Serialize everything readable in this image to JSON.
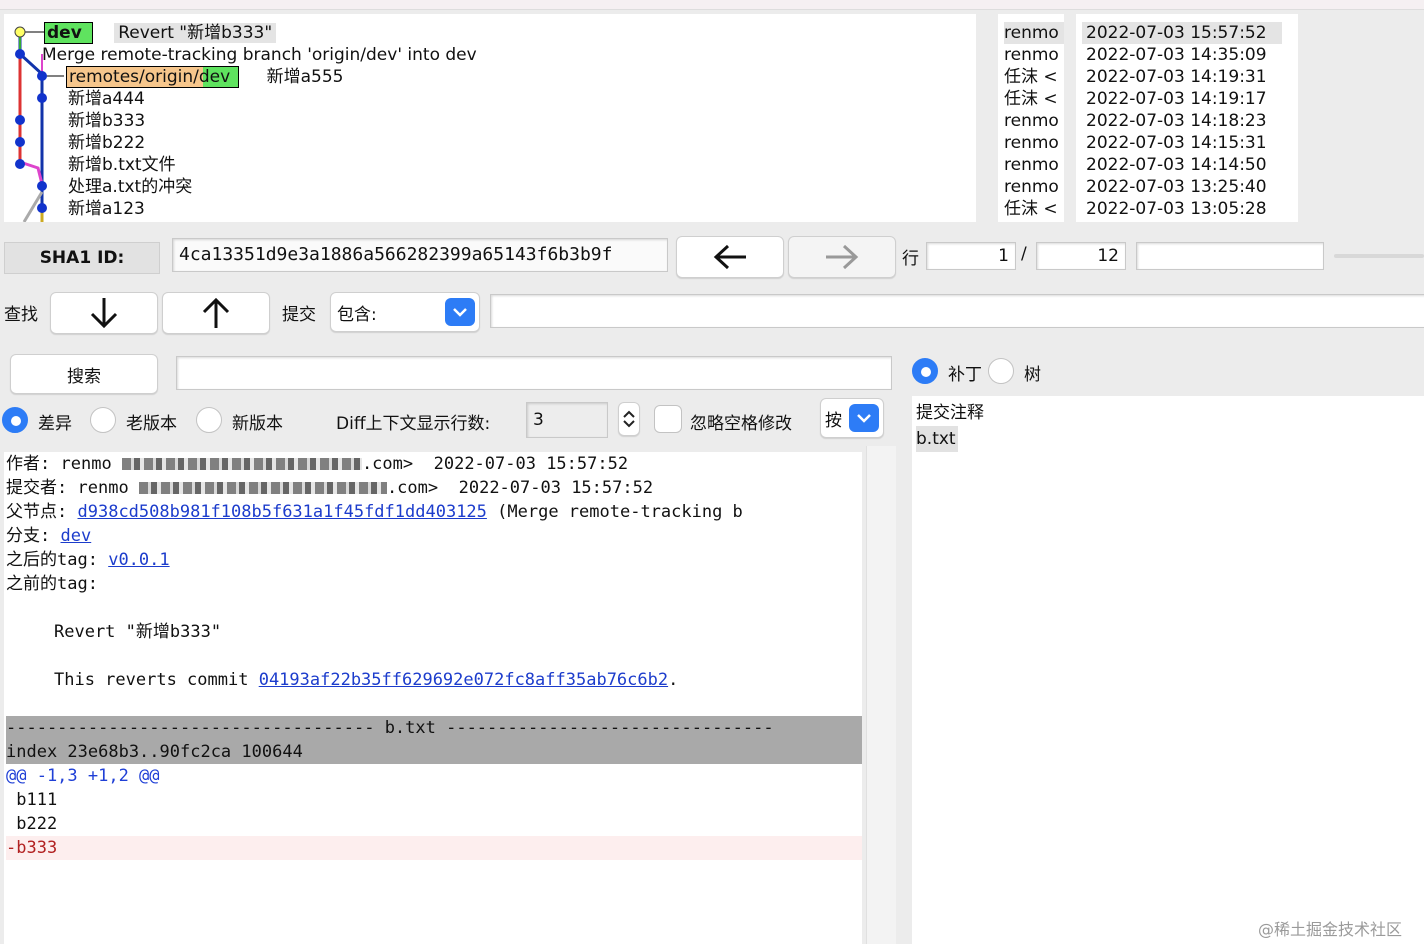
{
  "commits": [
    {
      "message": "Revert \"新增b333\"",
      "refs": [
        {
          "label": "dev",
          "kind": "local"
        }
      ]
    },
    {
      "message": "Merge remote-tracking branch 'origin/dev' into dev",
      "refs": []
    },
    {
      "message": "新增a555",
      "refs": [
        {
          "label": "remotes/origin/dev",
          "kind": "remote"
        }
      ]
    },
    {
      "message": "新增a444",
      "refs": []
    },
    {
      "message": "新增b333",
      "refs": []
    },
    {
      "message": "新增b222",
      "refs": []
    },
    {
      "message": "新增b.txt文件",
      "refs": []
    },
    {
      "message": "处理a.txt的冲突",
      "refs": []
    },
    {
      "message": "新增a123",
      "refs": []
    }
  ],
  "authors": [
    "renmo",
    "renmo",
    "任沫 <",
    "任沫 <",
    "renmo",
    "renmo",
    "renmo",
    "renmo",
    "任沫 <"
  ],
  "dates": [
    "2022-07-03 15:57:52",
    "2022-07-03 14:35:09",
    "2022-07-03 14:19:31",
    "2022-07-03 14:19:17",
    "2022-07-03 14:18:23",
    "2022-07-03 14:15:31",
    "2022-07-03 14:14:50",
    "2022-07-03 13:25:40",
    "2022-07-03 13:05:28"
  ],
  "sha": {
    "label": "SHA1 ID:",
    "value": "4ca13351d9e3a1886a566282399a65143f6b3b9f"
  },
  "nav": {
    "row_label": "行",
    "row_current": "1",
    "row_sep": "/",
    "row_total": "12"
  },
  "find": {
    "label": "查找",
    "commit_label": "提交",
    "mode": "包含:"
  },
  "search": {
    "button": "搜索"
  },
  "diff_options": {
    "diff": "差异",
    "old": "老版本",
    "new": "新版本",
    "context_label": "Diff上下文显示行数:",
    "context_value": "3",
    "ignore_ws": "忽略空格修改",
    "by": "按"
  },
  "right_options": {
    "patch": "补丁",
    "tree": "树"
  },
  "files": [
    "提交注释",
    "b.txt"
  ],
  "detail": {
    "author_label": "作者:",
    "author_name": "renmo",
    "author_email_tail": ".com>",
    "author_date": "2022-07-03 15:57:52",
    "committer_label": "提交者:",
    "committer_name": "renmo",
    "committer_email_tail": ".com>",
    "committer_date": "2022-07-03 15:57:52",
    "parent_label": "父节点:",
    "parent_sha": "d938cd508b981f108b5f631a1f45fdf1dd403125",
    "parent_desc": "(Merge remote-tracking b",
    "branch_label": "分支:",
    "branch": "dev",
    "follows_label": "之后的tag:",
    "follows_tag": "v0.0.1",
    "precedes_label": "之前的tag:",
    "message_title": "Revert \"新增b333\"",
    "message_body_prefix": "This reverts commit ",
    "message_body_sha": "04193af22b35ff629692e072fc8aff35ab76c6b2",
    "message_body_suffix": ".",
    "file_header": "------------------------------------ b.txt --------------------------------",
    "index_line": "index 23e68b3..90fc2ca 100644",
    "hunk": "@@ -1,3 +1,2 @@",
    "lines": [
      " b111",
      " b222"
    ],
    "removed": "-b333"
  },
  "watermark": "@稀土掘金技术社区",
  "colors": {
    "local_branch": "#5fe35f",
    "remote_branch": "#f6c68c",
    "link": "#1c3ccc",
    "removed": "#b22222",
    "hunk": "#1f3fd6",
    "accent": "#2d7cf6"
  }
}
